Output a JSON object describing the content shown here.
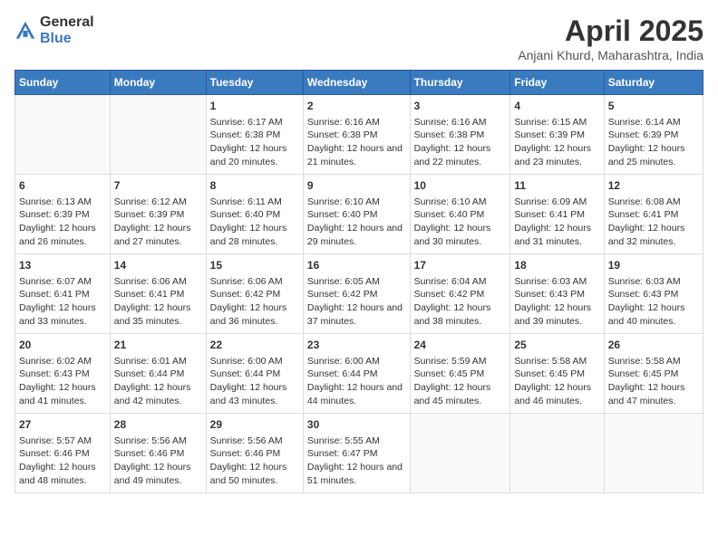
{
  "header": {
    "logo_general": "General",
    "logo_blue": "Blue",
    "title": "April 2025",
    "subtitle": "Anjani Khurd, Maharashtra, India"
  },
  "days_of_week": [
    "Sunday",
    "Monday",
    "Tuesday",
    "Wednesday",
    "Thursday",
    "Friday",
    "Saturday"
  ],
  "weeks": [
    [
      {
        "day": "",
        "content": ""
      },
      {
        "day": "",
        "content": ""
      },
      {
        "day": "1",
        "content": "Sunrise: 6:17 AM\nSunset: 6:38 PM\nDaylight: 12 hours and 20 minutes."
      },
      {
        "day": "2",
        "content": "Sunrise: 6:16 AM\nSunset: 6:38 PM\nDaylight: 12 hours and 21 minutes."
      },
      {
        "day": "3",
        "content": "Sunrise: 6:16 AM\nSunset: 6:38 PM\nDaylight: 12 hours and 22 minutes."
      },
      {
        "day": "4",
        "content": "Sunrise: 6:15 AM\nSunset: 6:39 PM\nDaylight: 12 hours and 23 minutes."
      },
      {
        "day": "5",
        "content": "Sunrise: 6:14 AM\nSunset: 6:39 PM\nDaylight: 12 hours and 25 minutes."
      }
    ],
    [
      {
        "day": "6",
        "content": "Sunrise: 6:13 AM\nSunset: 6:39 PM\nDaylight: 12 hours and 26 minutes."
      },
      {
        "day": "7",
        "content": "Sunrise: 6:12 AM\nSunset: 6:39 PM\nDaylight: 12 hours and 27 minutes."
      },
      {
        "day": "8",
        "content": "Sunrise: 6:11 AM\nSunset: 6:40 PM\nDaylight: 12 hours and 28 minutes."
      },
      {
        "day": "9",
        "content": "Sunrise: 6:10 AM\nSunset: 6:40 PM\nDaylight: 12 hours and 29 minutes."
      },
      {
        "day": "10",
        "content": "Sunrise: 6:10 AM\nSunset: 6:40 PM\nDaylight: 12 hours and 30 minutes."
      },
      {
        "day": "11",
        "content": "Sunrise: 6:09 AM\nSunset: 6:41 PM\nDaylight: 12 hours and 31 minutes."
      },
      {
        "day": "12",
        "content": "Sunrise: 6:08 AM\nSunset: 6:41 PM\nDaylight: 12 hours and 32 minutes."
      }
    ],
    [
      {
        "day": "13",
        "content": "Sunrise: 6:07 AM\nSunset: 6:41 PM\nDaylight: 12 hours and 33 minutes."
      },
      {
        "day": "14",
        "content": "Sunrise: 6:06 AM\nSunset: 6:41 PM\nDaylight: 12 hours and 35 minutes."
      },
      {
        "day": "15",
        "content": "Sunrise: 6:06 AM\nSunset: 6:42 PM\nDaylight: 12 hours and 36 minutes."
      },
      {
        "day": "16",
        "content": "Sunrise: 6:05 AM\nSunset: 6:42 PM\nDaylight: 12 hours and 37 minutes."
      },
      {
        "day": "17",
        "content": "Sunrise: 6:04 AM\nSunset: 6:42 PM\nDaylight: 12 hours and 38 minutes."
      },
      {
        "day": "18",
        "content": "Sunrise: 6:03 AM\nSunset: 6:43 PM\nDaylight: 12 hours and 39 minutes."
      },
      {
        "day": "19",
        "content": "Sunrise: 6:03 AM\nSunset: 6:43 PM\nDaylight: 12 hours and 40 minutes."
      }
    ],
    [
      {
        "day": "20",
        "content": "Sunrise: 6:02 AM\nSunset: 6:43 PM\nDaylight: 12 hours and 41 minutes."
      },
      {
        "day": "21",
        "content": "Sunrise: 6:01 AM\nSunset: 6:44 PM\nDaylight: 12 hours and 42 minutes."
      },
      {
        "day": "22",
        "content": "Sunrise: 6:00 AM\nSunset: 6:44 PM\nDaylight: 12 hours and 43 minutes."
      },
      {
        "day": "23",
        "content": "Sunrise: 6:00 AM\nSunset: 6:44 PM\nDaylight: 12 hours and 44 minutes."
      },
      {
        "day": "24",
        "content": "Sunrise: 5:59 AM\nSunset: 6:45 PM\nDaylight: 12 hours and 45 minutes."
      },
      {
        "day": "25",
        "content": "Sunrise: 5:58 AM\nSunset: 6:45 PM\nDaylight: 12 hours and 46 minutes."
      },
      {
        "day": "26",
        "content": "Sunrise: 5:58 AM\nSunset: 6:45 PM\nDaylight: 12 hours and 47 minutes."
      }
    ],
    [
      {
        "day": "27",
        "content": "Sunrise: 5:57 AM\nSunset: 6:46 PM\nDaylight: 12 hours and 48 minutes."
      },
      {
        "day": "28",
        "content": "Sunrise: 5:56 AM\nSunset: 6:46 PM\nDaylight: 12 hours and 49 minutes."
      },
      {
        "day": "29",
        "content": "Sunrise: 5:56 AM\nSunset: 6:46 PM\nDaylight: 12 hours and 50 minutes."
      },
      {
        "day": "30",
        "content": "Sunrise: 5:55 AM\nSunset: 6:47 PM\nDaylight: 12 hours and 51 minutes."
      },
      {
        "day": "",
        "content": ""
      },
      {
        "day": "",
        "content": ""
      },
      {
        "day": "",
        "content": ""
      }
    ]
  ]
}
